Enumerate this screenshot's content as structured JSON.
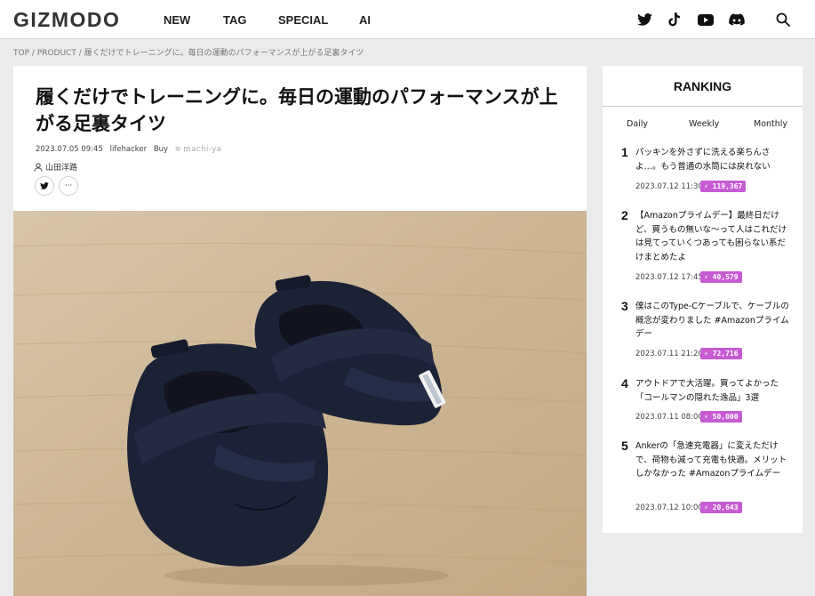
{
  "header": {
    "logo": "GIZMODO",
    "nav": [
      "NEW",
      "TAG",
      "SPECIAL",
      "AI"
    ],
    "icons": [
      "twitter-icon",
      "tiktok-icon",
      "youtube-icon",
      "discord-icon",
      "search-icon"
    ]
  },
  "breadcrumb": "TOP / PRODUCT / 履くだけでトレーニングに。毎日の運動のパフォーマンスが上がる足裏タイツ",
  "article": {
    "title": "履くだけでトレーニングに。毎日の運動のパフォーマンスが上がる足裏タイツ",
    "date": "2023.07.05 09:45",
    "source": "lifehacker",
    "category": "Buy",
    "credit": "machi-ya",
    "author": "山田洋路",
    "share_more": "···"
  },
  "ranking": {
    "heading": "RANKING",
    "tabs": [
      "Daily",
      "Weekly",
      "Monthly"
    ],
    "items": [
      {
        "num": "1",
        "title": "パッキンを外さずに洗える楽ちんさよ…。もう普通の水筒には戻れない",
        "date": "2023.07.12 11:30",
        "count": "119,367"
      },
      {
        "num": "2",
        "title": "【Amazonプライムデー】最終日だけど、買うもの無いな〜って人はこれだけは見てっていくつあっても困らない系だけまとめたよ",
        "date": "2023.07.12 17:45",
        "count": "40,579"
      },
      {
        "num": "3",
        "title": "僕はこのType-Cケーブルで、ケーブルの概念が変わりました #Amazonプライムデー",
        "date": "2023.07.11 21:20",
        "count": "72,716"
      },
      {
        "num": "4",
        "title": "アウトドアで大活躍。買ってよかった「コールマンの隠れた逸品」3選",
        "date": "2023.07.11 08:00",
        "count": "50,000"
      },
      {
        "num": "5",
        "title": "Ankerの「急速充電器」に変えただけで、荷物も減って充電も快適。メリットしかなかった #Amazonプライムデー",
        "date": "2023.07.12 10:00",
        "count": "20,643"
      }
    ]
  },
  "colors": {
    "badge": "#c65bd4",
    "background": "#ebebeb"
  }
}
